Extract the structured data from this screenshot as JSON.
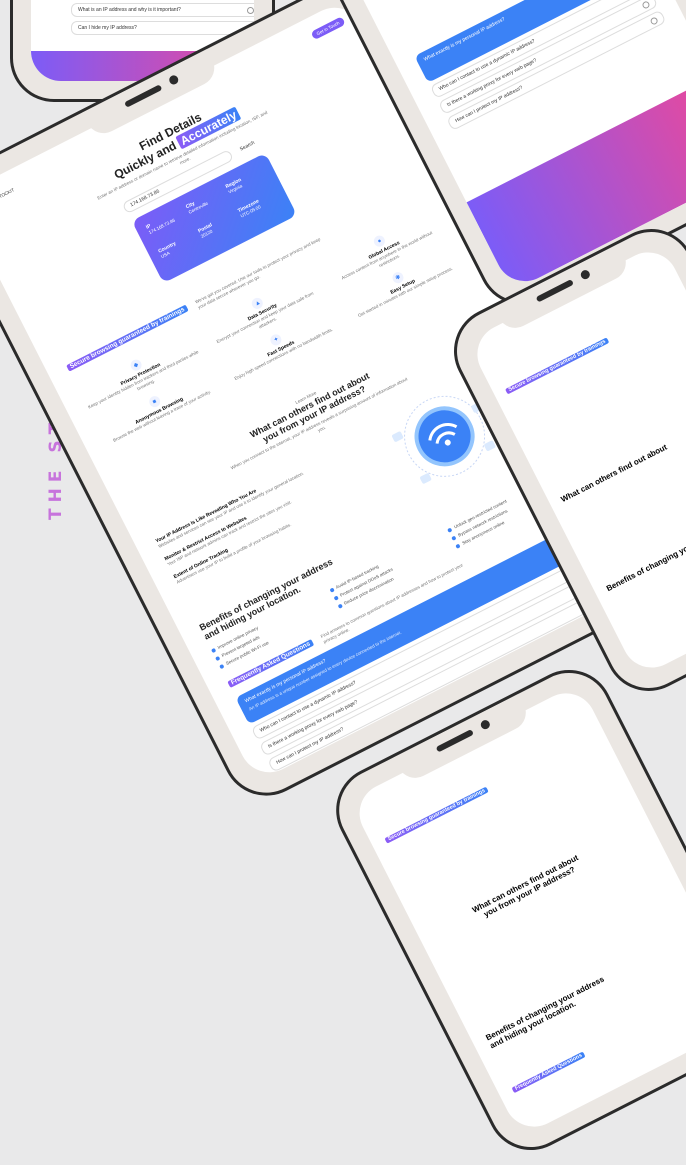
{
  "brand": {
    "text": "THE STOCKIT",
    "color": "#c774dc"
  },
  "colors": {
    "accent": "#3b82f6",
    "purple": "#7c5cf7",
    "pink": "#ec4899",
    "frame": "#2b2b2b",
    "bezel": "#ebe7e3",
    "background": "#e9e9ea"
  },
  "main": {
    "logo_text": "THE STOCKIT",
    "nav_button": "Get in Touch",
    "hero_title_line1": "Find Details",
    "hero_title_line2a": "Quickly and ",
    "hero_title_line2b": "Accurately",
    "hero_sub": "Enter an IP address or domain name to retrieve detailed information including location, ISP, and more.",
    "search_value": "174.168.73.86",
    "search_button": "Search",
    "result_card": {
      "ip_label": "IP",
      "ip_value": "174.168.73.86",
      "city_label": "City",
      "city_value": "Centreville",
      "country_label": "Country",
      "country_value": "USA",
      "region_label": "Region",
      "region_value": "Virginia",
      "timezone_label": "Timezone",
      "timezone_value": "UTC-05:00",
      "postal_label": "Postal",
      "postal_value": "20120"
    },
    "section_title": "Secure browsing guaranteed by trainings",
    "section_desc": "We've got you covered. Use our tools to protect your privacy and keep your data secure wherever you go.",
    "features": [
      {
        "icon": "shield-icon",
        "title": "Privacy Protection",
        "desc": "Keep your identity hidden from trackers and third parties while browsing."
      },
      {
        "icon": "lock-icon",
        "title": "Data Security",
        "desc": "Encrypt your connection and keep your data safe from attackers."
      },
      {
        "icon": "globe-icon",
        "title": "Global Access",
        "desc": "Access content from anywhere in the world without restrictions."
      },
      {
        "icon": "user-icon",
        "title": "Anonymous Browsing",
        "desc": "Browse the web without leaving a trace of your activity."
      },
      {
        "icon": "bolt-icon",
        "title": "Fast Speeds",
        "desc": "Enjoy high speed connections with no bandwidth limits."
      },
      {
        "icon": "gear-icon",
        "title": "Easy Setup",
        "desc": "Get started in minutes with our simple setup process."
      }
    ],
    "whatcan_kicker": "Learn More",
    "whatcan_title_line1": "What can others find out about",
    "whatcan_title_line2": "you from your IP address?",
    "whatcan_desc": "When you connect to the internet, your IP address reveals a surprising amount of information about you.",
    "whatcan_points": [
      {
        "title": "Your IP Address Is Like Revealing Who You Are",
        "desc": "Websites and services can see your IP and use it to identify your general location."
      },
      {
        "title": "Monitor & Restrict Access to Websites",
        "desc": "Your ISP and network admins can track and restrict the sites you visit."
      },
      {
        "title": "Extent of Online Tracking",
        "desc": "Advertisers use your IP to build a profile of your browsing habits."
      }
    ],
    "benefits_title_line1": "Benefits of changing your address",
    "benefits_title_line2": "and hiding your location.",
    "benefits": [
      "Improve online privacy",
      "Avoid IP-based tracking",
      "Unlock geo-restricted content",
      "Prevent targeted ads",
      "Protect against DDoS attacks",
      "Bypass network restrictions",
      "Secure public Wi-Fi use",
      "Reduce price discrimination",
      "Stay anonymous online"
    ],
    "faq_title": "Frequently Asked Questions",
    "faq_desc": "Find answers to common questions about IP addresses and how to protect your privacy online.",
    "faqs": [
      {
        "q": "What exactly is my personal IP address?",
        "a": "An IP address is a unique number assigned to every device connected to the internet."
      },
      {
        "q": "Who can I contact to use a dynamic IP address?"
      },
      {
        "q": "Is there a working proxy for every web page?"
      },
      {
        "q": "How can I protect my IP address?"
      },
      {
        "q": "What is an IP address and why is it important?"
      },
      {
        "q": "Can I hide my IP address?"
      }
    ]
  }
}
